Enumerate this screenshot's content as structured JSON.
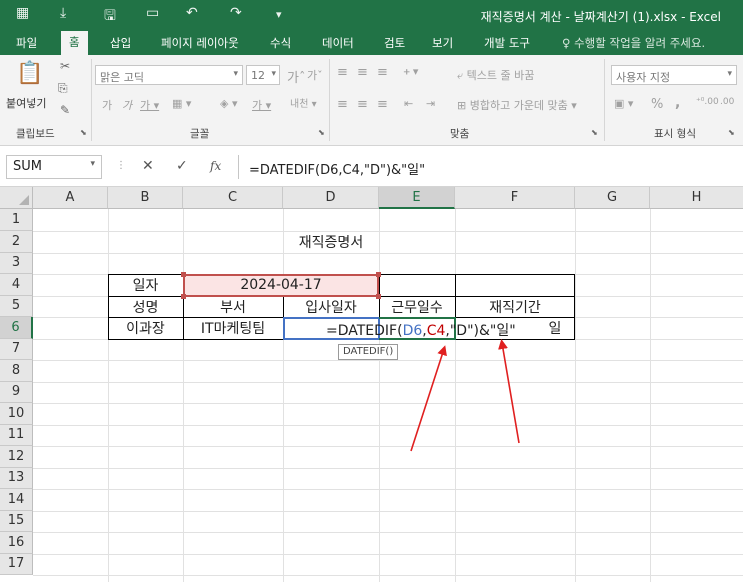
{
  "app": {
    "title": "재직증명서 계산 - 날짜계산기 (1).xlsx - Excel"
  },
  "ribbon_tabs": [
    "파일",
    "홈",
    "삽입",
    "페이지 레이아웃",
    "수식",
    "데이터",
    "검토",
    "보기",
    "개발 도구"
  ],
  "tell_me": "수행할 작업을 알려 주세요.",
  "ribbon": {
    "clipboard": {
      "paste_label": "붙여넣기",
      "group_label": "클립보드"
    },
    "font": {
      "font_name": "맑은 고딕",
      "font_size": "12",
      "group_label": "글꼴"
    },
    "alignment": {
      "wrap_text": "텍스트 줄 바꿈",
      "merge_center": "병합하고 가운데 맞춤",
      "group_label": "맞춤"
    },
    "number": {
      "format": "사용자 지정",
      "percent": "%",
      "comma": ",",
      "group_label": "표시 형식"
    }
  },
  "formula_bar": {
    "name_box": "SUM",
    "cancel": "✕",
    "enter": "✓",
    "fx": "fx",
    "formula": "=DATEDIF(D6,C4,\"D\")&\"일\""
  },
  "columns": [
    "A",
    "B",
    "C",
    "D",
    "E",
    "F",
    "G",
    "H"
  ],
  "rows": [
    "1",
    "2",
    "3",
    "4",
    "5",
    "6",
    "7",
    "8",
    "9",
    "10",
    "11",
    "12",
    "13",
    "14",
    "15",
    "16",
    "17"
  ],
  "sheet": {
    "title": "재직증명서",
    "date_label": "일자",
    "date_value": "2024-04-17",
    "headers": [
      "성명",
      "부서",
      "입사일자",
      "근무일수",
      "재직기간"
    ],
    "row6": {
      "name": "이과장",
      "dept": "IT마케팅팀",
      "formula_fn": "=DATEDIF(",
      "formula_ref1": "D6",
      "formula_comma1": ",",
      "formula_ref2": "C4",
      "formula_rest": ",\"D\")&\"일\"",
      "tenure_suffix": "일"
    },
    "tooltip": "DATEDIF()"
  },
  "colors": {
    "excel_green": "#217346",
    "arrow": "#e02020",
    "ref_blue": "#4472c4",
    "ref_red": "#c00000",
    "c4_fill": "#fbe4e4"
  }
}
